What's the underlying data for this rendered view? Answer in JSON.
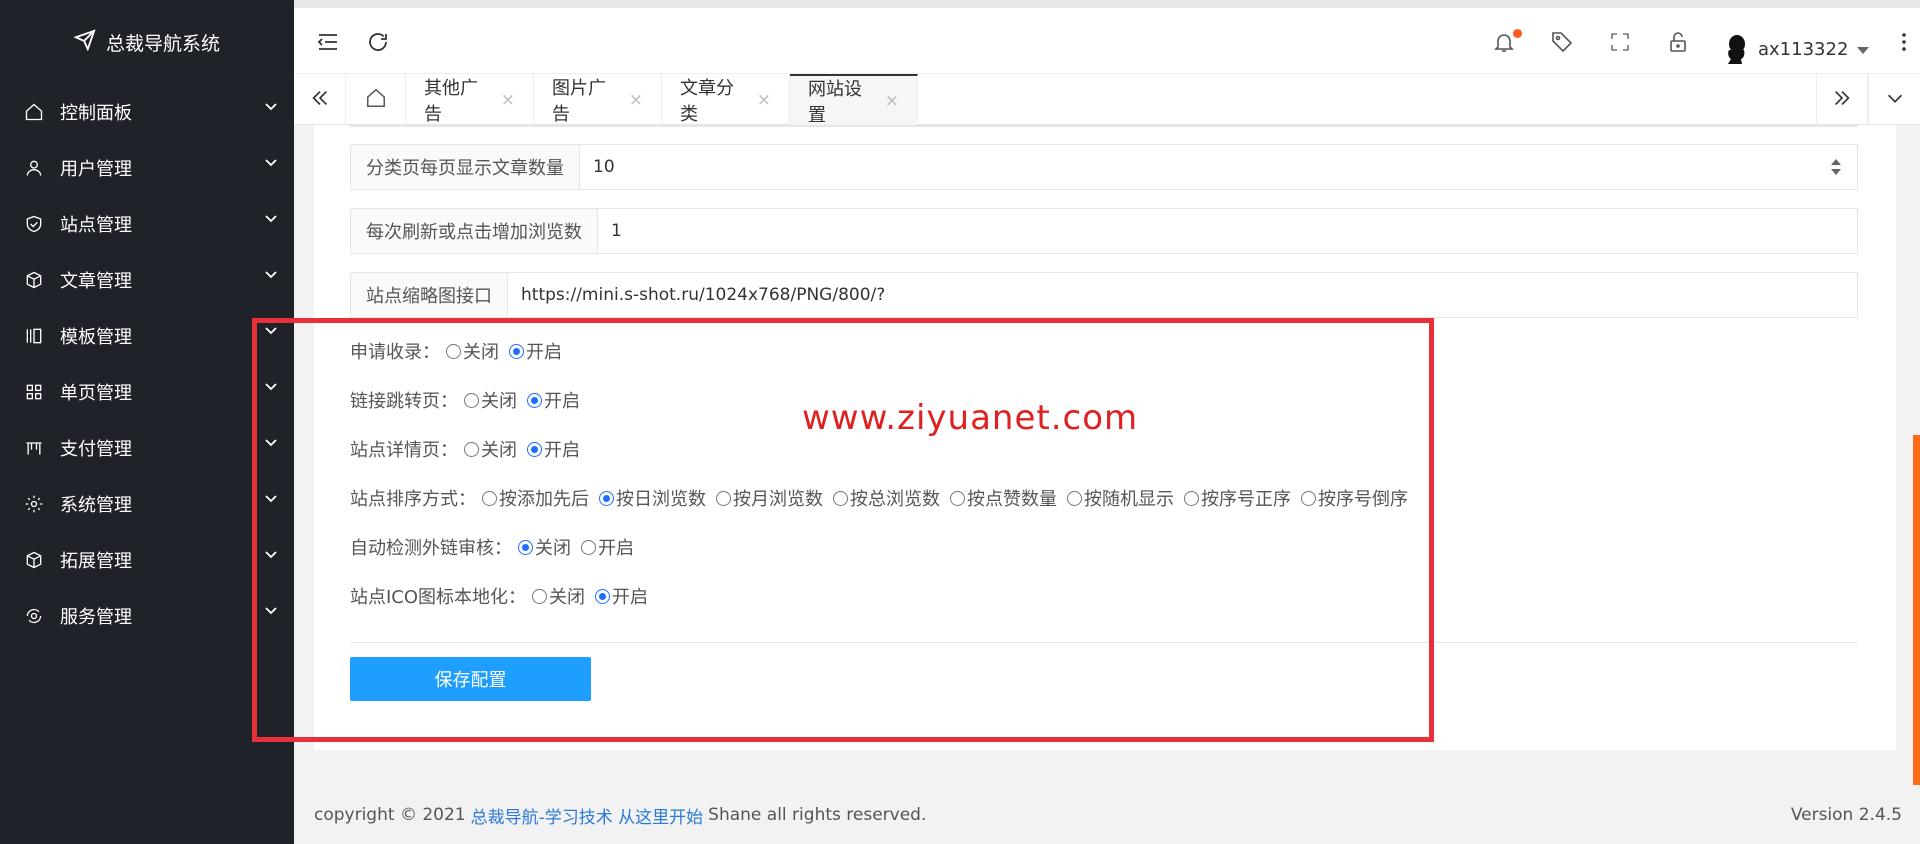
{
  "brand": {
    "name": "总裁导航系统"
  },
  "sidebar": {
    "items": [
      {
        "label": "控制面板",
        "icon": "home-icon"
      },
      {
        "label": "用户管理",
        "icon": "user-icon"
      },
      {
        "label": "站点管理",
        "icon": "shield-icon"
      },
      {
        "label": "文章管理",
        "icon": "cube-icon"
      },
      {
        "label": "模板管理",
        "icon": "template-icon"
      },
      {
        "label": "单页管理",
        "icon": "grid-icon"
      },
      {
        "label": "支付管理",
        "icon": "shop-icon"
      },
      {
        "label": "系统管理",
        "icon": "gear-icon"
      },
      {
        "label": "拓展管理",
        "icon": "cube-icon"
      },
      {
        "label": "服务管理",
        "icon": "service-icon"
      }
    ]
  },
  "header": {
    "username": "ax113322"
  },
  "tabs": [
    {
      "label": "其他广告"
    },
    {
      "label": "图片广告"
    },
    {
      "label": "文章分类"
    },
    {
      "label": "网站设置"
    }
  ],
  "form": {
    "fields": [
      {
        "label": "分类页每页显示文章数量",
        "value": "10"
      },
      {
        "label": "每次刷新或点击增加浏览数",
        "value": "1"
      },
      {
        "label": "站点缩略图接口",
        "value": "https://mini.s-shot.ru/1024x768/PNG/800/?"
      }
    ],
    "radios": [
      {
        "label": "申请收录：",
        "options": [
          "关闭",
          "开启"
        ],
        "selected": "开启"
      },
      {
        "label": "链接跳转页：",
        "options": [
          "关闭",
          "开启"
        ],
        "selected": "开启"
      },
      {
        "label": "站点详情页：",
        "options": [
          "关闭",
          "开启"
        ],
        "selected": "开启"
      },
      {
        "label": "站点排序方式：",
        "options": [
          "按添加先后",
          "按日浏览数",
          "按月浏览数",
          "按总浏览数",
          "按点赞数量",
          "按随机显示",
          "按序号正序",
          "按序号倒序"
        ],
        "selected": "按日浏览数"
      },
      {
        "label": "自动检测外链审核：",
        "options": [
          "关闭",
          "开启"
        ],
        "selected": "关闭"
      },
      {
        "label": "站点ICO图标本地化：",
        "options": [
          "关闭",
          "开启"
        ],
        "selected": "开启"
      }
    ],
    "save_label": "保存配置"
  },
  "watermark": "www.ziyuanet.com",
  "footer": {
    "copyright": "copyright © 2021",
    "link_text": "总裁导航-学习技术 从这里开始",
    "rights": "Shane all rights reserved.",
    "version": "Version 2.4.5"
  },
  "colors": {
    "sidebar_bg": "#20222a",
    "primary": "#1e9fff",
    "highlight_border": "#e8303a",
    "notification_dot": "#ff5722"
  }
}
